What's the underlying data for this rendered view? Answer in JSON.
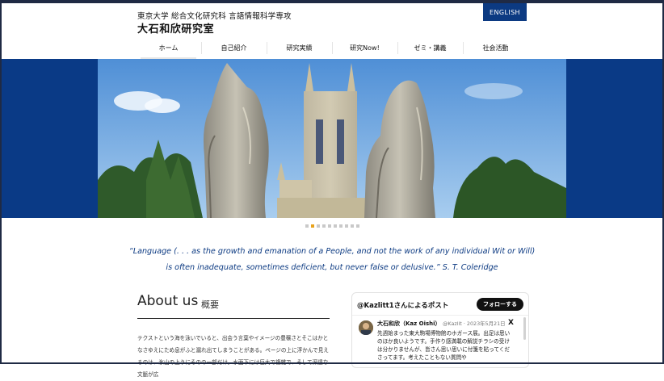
{
  "header": {
    "org": "東京大学 総合文化研究科 言語情報科学専攻",
    "title": "大石和欣研究室",
    "lang_button": "ENGLISH"
  },
  "nav": [
    {
      "label": "ホーム",
      "active": true
    },
    {
      "label": "自己紹介"
    },
    {
      "label": "研究実績"
    },
    {
      "label": "研究Now!"
    },
    {
      "label": "ゼミ・講義"
    },
    {
      "label": "社会活動"
    }
  ],
  "carousel": {
    "slides": 10,
    "active_index": 1
  },
  "quote": {
    "line1": "“Language (. . . as the growth and emanation of a People, and not the work of any individual Wit or Will)",
    "line2": "is often inadequate, sometimes deficient, but never false or delusive.” S. T. Coleridge"
  },
  "about": {
    "title": "About us",
    "subtitle": "概要",
    "text": "テクストという海を泳いでいると、出会う言葉やイメージの豊穣さとそこはかとなさゆえにため息がふと漏れ出てしまうことがある。ページの上に浮かんで見えるのは、氷山の上うにそのの一部だけ。水面下には巨大で複雑で、そして深遠な文脈が広"
  },
  "twitter": {
    "header": "@Kazlitt1さんによるポスト",
    "follow_label": "フォローする",
    "name": "大石和欣（Kaz Oishi）",
    "handle_date": "@Kazlit · 2023年5月21日",
    "x_icon": "X",
    "body": "先週始まった東大駒場博物館のホガース展。出足は思いのほか良いようです。手作り感満載の解説チラシの受けは分かりませんが、皆さん思い思いに付箋を貼ってくださってます。考えたこともない質問や"
  },
  "colors": {
    "brand_blue": "#0c3a82",
    "dot_active": "#e8a31c"
  }
}
